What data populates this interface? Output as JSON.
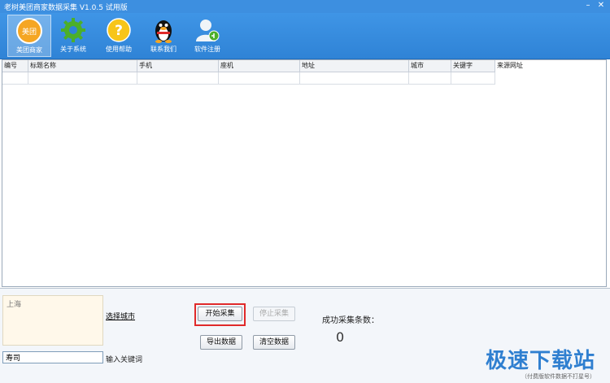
{
  "window": {
    "title": "老树美团商家数据采集 V1.0.5 试用版",
    "min_label": "–",
    "close_label": "✕"
  },
  "toolbar": {
    "items": [
      {
        "label": "美团商家",
        "icon": "meituan-logo-icon",
        "active": true
      },
      {
        "label": "关于系统",
        "icon": "gear-icon"
      },
      {
        "label": "使用帮助",
        "icon": "help-icon"
      },
      {
        "label": "联系我们",
        "icon": "qq-penguin-icon"
      },
      {
        "label": "软件注册",
        "icon": "user-register-icon"
      }
    ],
    "logo_text": "美团"
  },
  "grid": {
    "columns": [
      "编号",
      "标题名称",
      "手机",
      "座机",
      "地址",
      "城市",
      "关键字",
      "来源网址"
    ],
    "rows": []
  },
  "panel": {
    "city_value": "上海",
    "choose_city_label": "选择城市",
    "keyword_value": "寿司",
    "keyword_label": "输入关键词",
    "start_button": "开始采集",
    "stop_button": "停止采集",
    "export_button": "导出数据",
    "clear_button": "清空数据",
    "count_label": "成功采集条数：",
    "count_value": "0"
  },
  "watermark": {
    "logo": "极速下载站",
    "sub": "（付费版软件数据不打星号）"
  },
  "colors": {
    "toolbar_blue": "#3f95e6",
    "highlight_red": "#e02a2a",
    "city_box_bg": "#fff8ea"
  }
}
